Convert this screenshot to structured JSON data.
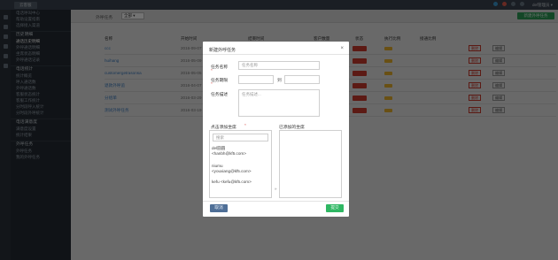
{
  "topbar": {
    "tab_label": "云客服",
    "user_label": "del管理员 ▾",
    "icon_colors": [
      "#3b9bd5",
      "#e25c4c",
      "#6c7a88",
      "#6c7a88"
    ]
  },
  "sidebar": {
    "items": [
      {
        "label": "电话呼叫中心",
        "type": "item"
      },
      {
        "label": "帮助设置指南",
        "type": "item"
      },
      {
        "label": "选择接入渠道",
        "type": "item"
      },
      {
        "label": "历史明细",
        "type": "group"
      },
      {
        "label": "通话历史明细",
        "type": "item",
        "active": true
      },
      {
        "label": "外呼通话明细",
        "type": "item"
      },
      {
        "label": "坐席状态明细",
        "type": "item"
      },
      {
        "label": "外呼通话记录",
        "type": "item"
      },
      {
        "label": "电话统计",
        "type": "group"
      },
      {
        "label": "统计概览",
        "type": "item"
      },
      {
        "label": "呼入通话数",
        "type": "item"
      },
      {
        "label": "外呼通话数",
        "type": "item"
      },
      {
        "label": "客服状态统计",
        "type": "item"
      },
      {
        "label": "客服工作统计",
        "type": "item"
      },
      {
        "label": "分时段呼入统计",
        "type": "item"
      },
      {
        "label": "分时段外呼统计",
        "type": "item"
      },
      {
        "label": "电话满意度",
        "type": "group"
      },
      {
        "label": "满意度设置",
        "type": "item"
      },
      {
        "label": "统计结果",
        "type": "item"
      },
      {
        "label": "外呼任务",
        "type": "group"
      },
      {
        "label": "外呼任务",
        "type": "item"
      },
      {
        "label": "我的外呼任务",
        "type": "item"
      }
    ]
  },
  "header": {
    "title": "外呼任务",
    "filter_value": "全部 ▾",
    "new_button": "新建外呼任务"
  },
  "table": {
    "columns": [
      "名称",
      "开始时间",
      "结束时间",
      "客户数量",
      "状态",
      "执行比例",
      "接通比例"
    ],
    "rows": [
      {
        "name": "ccc",
        "date": "2016-09-07"
      },
      {
        "name": "huihang",
        "date": "2016-05-09"
      },
      {
        "name": "customergetrasonsa",
        "date": "2016-05-05"
      },
      {
        "name": "退款外呼追",
        "date": "2016-04-07"
      },
      {
        "name": "分组单",
        "date": "2016-03-29"
      },
      {
        "name": "测试外呼任务",
        "date": "2016-03-19"
      }
    ],
    "delete_label": "删除",
    "edit_label": "编辑"
  },
  "modal": {
    "title": "新建外呼任务",
    "close": "×",
    "name_label": "任务名称",
    "name_placeholder": "任务名称",
    "period_label": "任务期限",
    "period_sep": "到",
    "desc_label": "任务描述",
    "desc_placeholder": "任务描述...",
    "required_mark": "*",
    "seat_list_label": "点击添加坐席",
    "added_label": "已添加的坐席",
    "search_placeholder": "搜索",
    "seats": [
      {
        "line1": "del圆圆",
        "line2": "<hanbh@kf5.com>"
      },
      {
        "line1": "niumu",
        "line2": "<youxiang@kf5.com>"
      },
      {
        "line1": "kefu <kefu@kf5.com>",
        "line2": ""
      }
    ],
    "arrow": "»",
    "cancel": "取消",
    "submit": "提交"
  }
}
